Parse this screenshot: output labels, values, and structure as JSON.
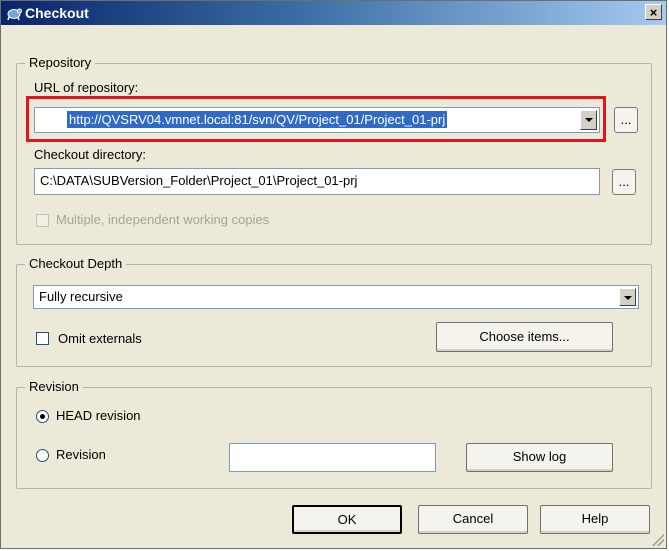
{
  "window": {
    "title": "Checkout",
    "close_label": "×"
  },
  "repository": {
    "legend": "Repository",
    "url_label": "URL of repository:",
    "url_value": "http://QVSRV04.vmnet.local:81/svn/QV/Project_01/Project_01-prj",
    "browse_label": "...",
    "dir_label": "Checkout directory:",
    "dir_value": "C:\\DATA\\SUBVersion_Folder\\Project_01\\Project_01-prj",
    "dir_browse_label": "...",
    "multiple_label": "Multiple, independent working copies"
  },
  "depth": {
    "legend": "Checkout Depth",
    "value": "Fully recursive",
    "omit_label": "Omit externals",
    "choose_label": "Choose items..."
  },
  "revision": {
    "legend": "Revision",
    "head_label": "HEAD revision",
    "rev_label": "Revision",
    "rev_value": "",
    "showlog_label": "Show log"
  },
  "buttons": {
    "ok": "OK",
    "cancel": "Cancel",
    "help": "Help"
  },
  "colors": {
    "highlight": "#e0141b",
    "selection": "#316ac5",
    "titlebar": "#0a246a"
  }
}
